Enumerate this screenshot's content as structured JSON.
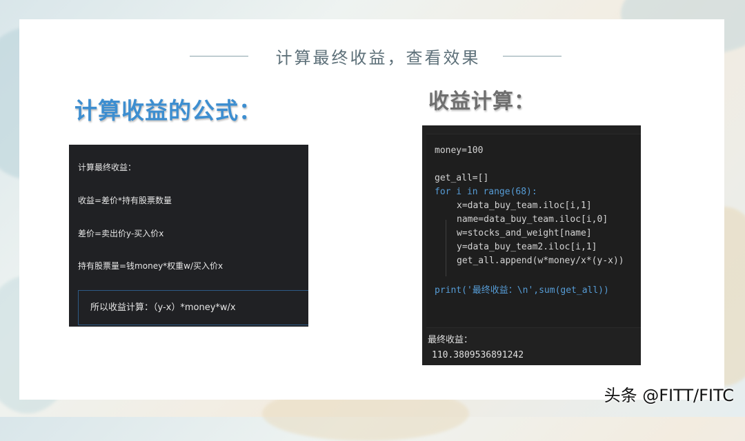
{
  "slide_title": "计算最终收益，查看效果",
  "left_heading": "计算收益的公式：",
  "right_heading": "收益计算：",
  "formula_lines": [
    "计算最终收益：",
    "收益=差价*持有股票数量",
    "差价=卖出价y-买入价x",
    "持有股票量=钱money*权重w/买入价x"
  ],
  "formula_box": "所以收益计算：（y-x）*money*w/x",
  "code": {
    "line_money": "money=100",
    "line_getall": "get_all=[]",
    "line_for": "for i in range(68):",
    "line_x": "x=data_buy_team.iloc[i,1]",
    "line_name": "name=data_buy_team.iloc[i,0]",
    "line_w": "w=stocks_and_weight[name]",
    "line_y": "y=data_buy_team2.iloc[i,1]",
    "line_append": "get_all.append(w*money/x*(y-x))",
    "line_print": "print('最终收益：\\n',sum(get_all))"
  },
  "output_label": "最终收益：",
  "output_value": "110.3809536891242",
  "watermark": "头条 @FITT/FITC",
  "colors": {
    "left_heading": "#3d8ed0",
    "right_heading": "#6f6f6f",
    "panel_bg": "#202124",
    "keyword": "#569cd6",
    "number": "#b5cea8",
    "string": "#ce9178"
  }
}
